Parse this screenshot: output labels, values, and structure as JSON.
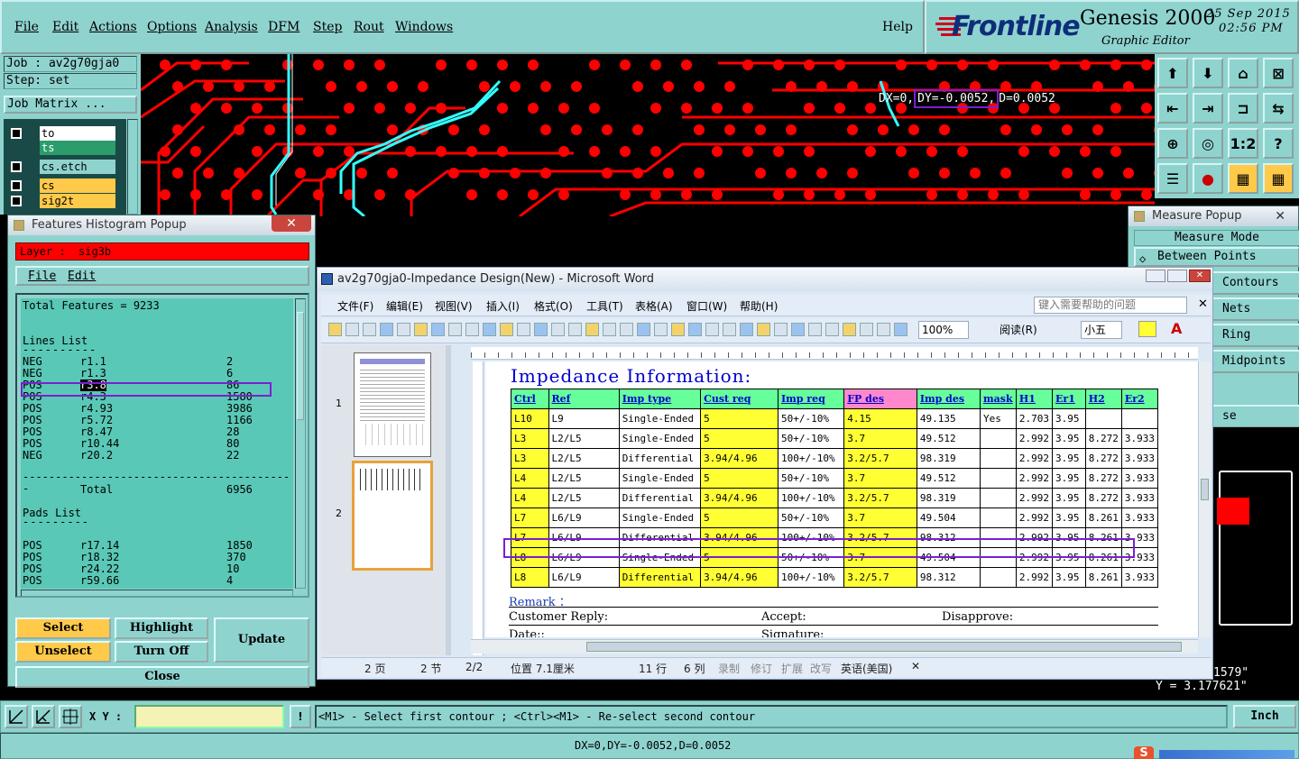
{
  "menubar": {
    "items": [
      "File",
      "Edit",
      "Actions",
      "Options",
      "Analysis",
      "DFM",
      "Step",
      "Rout",
      "Windows"
    ],
    "help": "Help"
  },
  "brand": {
    "logo": "Frontline",
    "product": "Genesis 2000",
    "subtitle": "Graphic Editor",
    "date": "25 Sep 2015",
    "time": "02:56 PM"
  },
  "job": {
    "job_label": "Job : av2g70gja0",
    "step_label": "Step: set",
    "matrix_button": "Job Matrix ..."
  },
  "layers": [
    {
      "name": "to",
      "color": "#ffffff"
    },
    {
      "name": "ts",
      "color": "#2a9d6a"
    },
    {
      "name": "cs.etch",
      "color": "#8fd3cf"
    },
    {
      "name": "cs",
      "color": "#ffc94a"
    },
    {
      "name": "sig2t",
      "color": "#ffc94a"
    }
  ],
  "measure_overlay": {
    "dx": "DX=0,",
    "dy": "DY=-0.0052,",
    "d": "D=0.0052"
  },
  "histogram": {
    "title": "Features Histogram Popup",
    "layer_label": "Layer :",
    "layer_value": "sig3b",
    "menu": [
      "File",
      "Edit"
    ],
    "total": "Total Features = 9233",
    "lines_header": "Lines List",
    "lines": [
      {
        "pol": "NEG",
        "sym": "r1.1",
        "count": "2"
      },
      {
        "pol": "NEG",
        "sym": "r1.3",
        "count": "6"
      },
      {
        "pol": "POS",
        "sym": "r3.8",
        "count": "86"
      },
      {
        "pol": "POS",
        "sym": "r4.3",
        "count": "1580"
      },
      {
        "pol": "POS",
        "sym": "r4.93",
        "count": "3986"
      },
      {
        "pol": "POS",
        "sym": "r5.72",
        "count": "1166"
      },
      {
        "pol": "POS",
        "sym": "r8.47",
        "count": "28"
      },
      {
        "pol": "POS",
        "sym": "r10.44",
        "count": "80"
      },
      {
        "pol": "NEG",
        "sym": "r20.2",
        "count": "22"
      }
    ],
    "total_label": "Total",
    "total_value": "6956",
    "pads_header": "Pads List",
    "pads": [
      {
        "pol": "POS",
        "sym": "r17.14",
        "count": "1850"
      },
      {
        "pol": "POS",
        "sym": "r18.32",
        "count": "370"
      },
      {
        "pol": "POS",
        "sym": "r24.22",
        "count": "10"
      },
      {
        "pol": "POS",
        "sym": "r59.66",
        "count": "4"
      }
    ],
    "buttons": {
      "select": "Select",
      "highlight": "Highlight",
      "update": "Update",
      "unselect": "Unselect",
      "turn_off": "Turn Off",
      "close": "Close"
    }
  },
  "measure": {
    "title": "Measure Popup",
    "mode_header": "Measure Mode",
    "mode": "Between Points",
    "options": [
      "Contours",
      "Nets",
      "Ring",
      "Midpoints"
    ],
    "partial": "se",
    "coord1": "1579\"",
    "coord2": "Y = 3.177621\""
  },
  "word": {
    "title": "av2g70gja0-Impedance Design(New) - Microsoft Word",
    "menus": [
      "文件(F)",
      "编辑(E)",
      "视图(V)",
      "插入(I)",
      "格式(O)",
      "工具(T)",
      "表格(A)",
      "窗口(W)",
      "帮助(H)"
    ],
    "help_box": "键入需要帮助的问题",
    "zoom": "100%",
    "read_btn": "阅读(R)",
    "font_size": "小五",
    "doc_heading": "Impedance Information:",
    "table_headers": [
      "Ctrl",
      "Ref",
      "Imp type",
      "Cust req",
      "Imp req",
      "FP des",
      "Imp des",
      "mask",
      "H1",
      "Er1",
      "H2",
      "Er2"
    ],
    "rows": [
      [
        "L10",
        "L9",
        "Single-Ended",
        "5",
        "50+/-10%",
        "4.15",
        "49.135",
        "Yes",
        "2.703",
        "3.95",
        "",
        ""
      ],
      [
        "L3",
        "L2/L5",
        "Single-Ended",
        "5",
        "50+/-10%",
        "3.7",
        "49.512",
        "",
        "2.992",
        "3.95",
        "8.272",
        "3.933"
      ],
      [
        "L3",
        "L2/L5",
        "Differential",
        "3.94/4.96",
        "100+/-10%",
        "3.2/5.7",
        "98.319",
        "",
        "2.992",
        "3.95",
        "8.272",
        "3.933"
      ],
      [
        "L4",
        "L2/L5",
        "Single-Ended",
        "5",
        "50+/-10%",
        "3.7",
        "49.512",
        "",
        "2.992",
        "3.95",
        "8.272",
        "3.933"
      ],
      [
        "L4",
        "L2/L5",
        "Differential",
        "3.94/4.96",
        "100+/-10%",
        "3.2/5.7",
        "98.319",
        "",
        "2.992",
        "3.95",
        "8.272",
        "3.933"
      ],
      [
        "L7",
        "L6/L9",
        "Single-Ended",
        "5",
        "50+/-10%",
        "3.7",
        "49.504",
        "",
        "2.992",
        "3.95",
        "8.261",
        "3.933"
      ],
      [
        "L7",
        "L6/L9",
        "Differential",
        "3.94/4.96",
        "100+/-10%",
        "3.2/5.7",
        "98.312",
        "",
        "2.992",
        "3.95",
        "8.261",
        "3.933"
      ],
      [
        "L8",
        "L6/L9",
        "Single-Ended",
        "5",
        "50+/-10%",
        "3.7",
        "49.504",
        "",
        "2.992",
        "3.95",
        "8.261",
        "3.933"
      ],
      [
        "L8",
        "L6/L9",
        "Differential",
        "3.94/4.96",
        "100+/-10%",
        "3.2/5.7",
        "98.312",
        "",
        "2.992",
        "3.95",
        "8.261",
        "3.933"
      ]
    ],
    "remark": "Remark ：",
    "reply": "Customer Reply:",
    "accept": "Accept:",
    "disapprove": "Disapprove:",
    "date": "Date::",
    "signature": "Signature:",
    "thumb_pages": [
      "1",
      "2"
    ],
    "status": [
      "2 页",
      "2 节",
      "2/2",
      "位置 7.1厘米",
      "11 行",
      "6 列",
      "录制",
      "修订",
      "扩展",
      "改写",
      "英语(美国)"
    ]
  },
  "cmd": {
    "xy_label": "X Y :",
    "xy_value": "",
    "prompt": "<M1> - Select first contour ; <Ctrl><M1> - Re-select second contour",
    "units": "Inch"
  },
  "status": {
    "text": "DX=0,DY=-0.0052,D=0.0052"
  }
}
